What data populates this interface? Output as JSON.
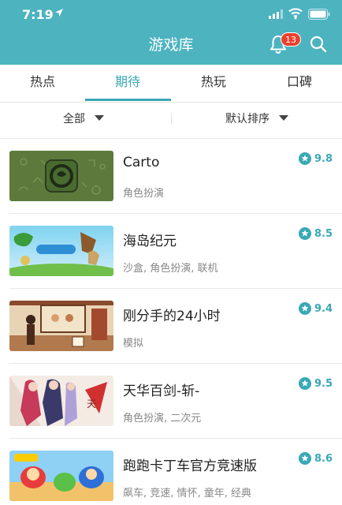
{
  "status_bar": {
    "time": "7:19"
  },
  "header": {
    "title": "游戏库",
    "notification_count": "13"
  },
  "tabs": [
    {
      "label": "热点"
    },
    {
      "label": "期待"
    },
    {
      "label": "热玩"
    },
    {
      "label": "口碑"
    }
  ],
  "filters": {
    "category": "全部",
    "sort": "默认排序"
  },
  "games": [
    {
      "name": "Carto",
      "tags": "角色扮演",
      "rating": "9.8"
    },
    {
      "name": "海岛纪元",
      "tags": "沙盒, 角色扮演, 联机",
      "rating": "8.5"
    },
    {
      "name": "刚分手的24小时",
      "tags": "模拟",
      "rating": "9.4"
    },
    {
      "name": "天华百剑-斩-",
      "tags": "角色扮演, 二次元",
      "rating": "9.5"
    },
    {
      "name": "跑跑卡丁车官方竞速版",
      "tags": "飙车, 竞速, 情怀, 童年, 经典",
      "rating": "8.6"
    }
  ],
  "colors": {
    "header_bg": "#4cb3bf",
    "accent": "#3aa8b5",
    "badge": "#e8412e"
  }
}
